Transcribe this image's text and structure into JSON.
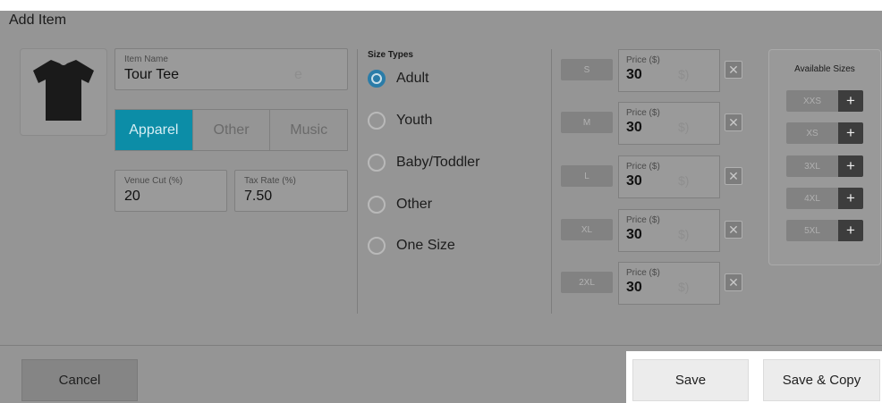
{
  "dialog": {
    "title": "Add Item"
  },
  "item": {
    "name_label": "Item Name",
    "name_value": "Tour Tee",
    "name_ghost": "e",
    "categories": [
      {
        "label": "Apparel",
        "active": true
      },
      {
        "label": "Other",
        "active": false
      },
      {
        "label": "Music",
        "active": false
      }
    ],
    "venue_cut_label": "Venue Cut (%)",
    "venue_cut_value": "20",
    "tax_rate_label": "Tax Rate (%)",
    "tax_rate_value": "7.50"
  },
  "size_types": {
    "title": "Size Types",
    "options": [
      {
        "label": "Adult",
        "selected": true
      },
      {
        "label": "Youth",
        "selected": false
      },
      {
        "label": "Baby/Toddler",
        "selected": false
      },
      {
        "label": "Other",
        "selected": false
      },
      {
        "label": "One Size",
        "selected": false
      }
    ]
  },
  "prices": {
    "label": "Price ($)",
    "ghost": "$)",
    "remove_glyph": "✕",
    "rows": [
      {
        "size": "S",
        "value": "30"
      },
      {
        "size": "M",
        "value": "30"
      },
      {
        "size": "L",
        "value": "30"
      },
      {
        "size": "XL",
        "value": "30"
      },
      {
        "size": "2XL",
        "value": "30"
      }
    ]
  },
  "available_sizes": {
    "title": "Available Sizes",
    "add_glyph": "+",
    "sizes": [
      "XXS",
      "XS",
      "3XL",
      "4XL",
      "5XL"
    ]
  },
  "footer": {
    "cancel_label": "Cancel",
    "save_label": "Save",
    "save_copy_label": "Save & Copy"
  },
  "colors": {
    "accent": "#0c8da7",
    "radio_selected": "#2a7ca8",
    "overlay": "#959595"
  },
  "icons": {
    "thumbnail": "t-shirt-icon",
    "remove": "close-icon",
    "add": "plus-icon"
  }
}
